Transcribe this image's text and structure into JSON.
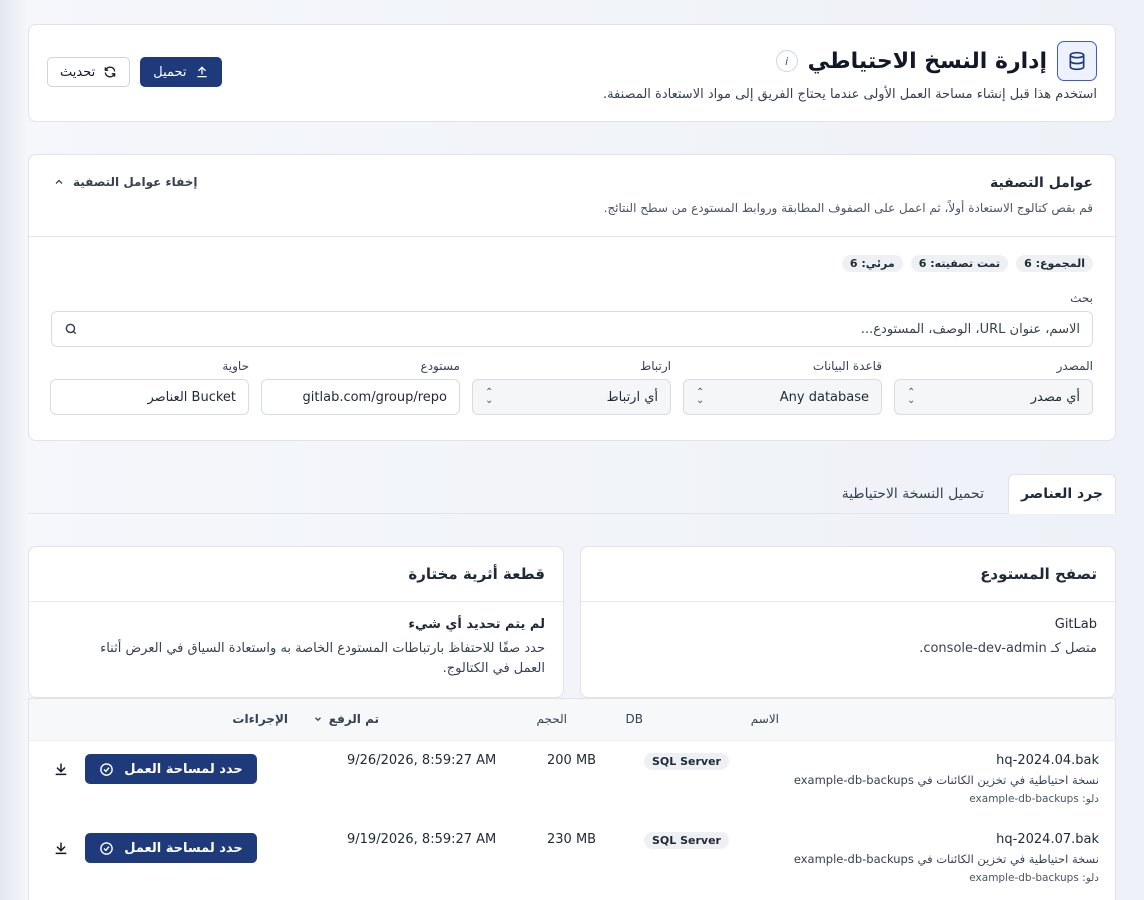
{
  "header": {
    "title": "إدارة النسخ الاحتياطي",
    "info": "i",
    "subtitle": "استخدم هذا قبل إنشاء مساحة العمل الأولى عندما يحتاج الفريق إلى مواد الاستعادة المصنفة.",
    "refresh_label": "تحديث",
    "upload_label": "تحميل"
  },
  "filters": {
    "title": "عوامل التصفية",
    "description": "قم بقص كتالوج الاستعادة أولاً، ثم اعمل على الصفوف المطابقة وروابط المستودع من سطح النتائج.",
    "hide_label": "إخفاء عوامل التصفية",
    "badges": [
      "المجموع: 6",
      "تمت تصفيته: 6",
      "مرئي: 6"
    ],
    "search_label": "بحث",
    "search_placeholder": "الاسم، عنوان URL، الوصف، المستودع...",
    "source_label": "المصدر",
    "source_value": "أي مصدر",
    "database_label": "قاعدة البيانات",
    "database_value": "Any database",
    "link_label": "ارتباط",
    "link_value": "أي ارتباط",
    "repo_label": "مستودع",
    "repo_value": "gitlab.com/group/repo",
    "container_label": "حاوية",
    "container_value": "Bucket العناصر"
  },
  "tabs": [
    {
      "label": "جرد العناصر",
      "active": true
    },
    {
      "label": "تحميل النسخة الاحتياطية",
      "active": false
    }
  ],
  "repo_panel": {
    "title": "تصفح المستودع",
    "provider": "GitLab",
    "connected": "متصل كـ console-dev-admin."
  },
  "artifact_panel": {
    "title": "قطعة أثرية مختارة",
    "empty_title": "لم يتم تحديد أي شيء",
    "empty_line1": "حدد صفًا للاحتفاظ بارتباطات المستودع الخاصة به واستعادة السياق في العرض أثناء",
    "empty_line2": "العمل في الكتالوج."
  },
  "table": {
    "headers": {
      "name": "الاسم",
      "db": "DB",
      "size": "الحجم",
      "uploaded": "تم الرفع",
      "actions": "الإجراءات"
    },
    "rows": [
      {
        "name": "hq-2024.04.bak",
        "desc": "نسخة احتياطية في تخزين الكائنات في example-db-backups",
        "bucket": "دلو: example-db-backups",
        "db": "SQL Server",
        "size": "200 MB",
        "uploaded": "9/26/2026, 8:59:27 AM",
        "action": "حدد لمساحة العمل"
      },
      {
        "name": "hq-2024.07.bak",
        "desc": "نسخة احتياطية في تخزين الكائنات في example-db-backups",
        "bucket": "دلو: example-db-backups",
        "db": "SQL Server",
        "size": "230 MB",
        "uploaded": "9/19/2026, 8:59:27 AM",
        "action": "حدد لمساحة العمل"
      }
    ]
  },
  "colors": {
    "primary": "#1e3a7b",
    "accent": "#3b5bdb"
  }
}
